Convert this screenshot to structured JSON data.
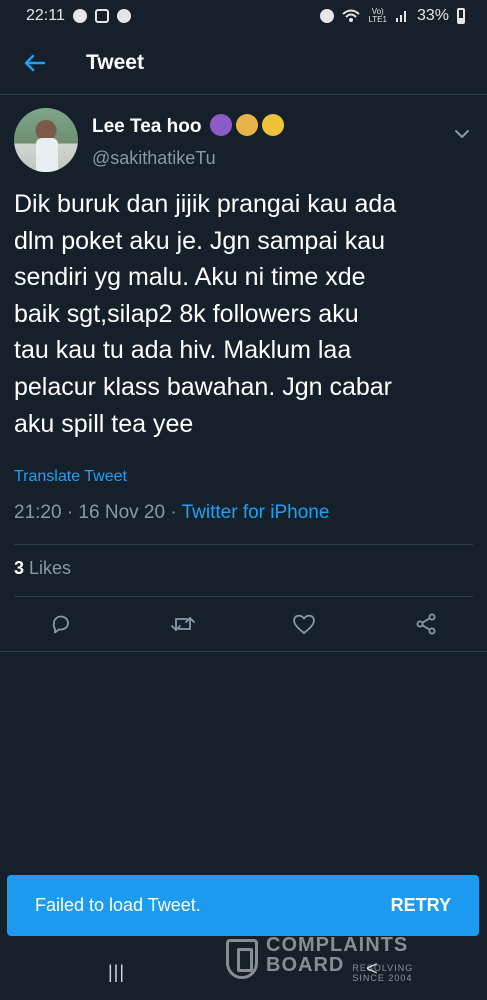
{
  "status_bar": {
    "time": "22:11",
    "network_label": "Vo)\nLTE1",
    "battery": "33%"
  },
  "header": {
    "title": "Tweet"
  },
  "tweet": {
    "author": {
      "display_name": "Lee Tea hoo",
      "handle": "@sakithatikeTu"
    },
    "text": "Dik buruk dan jijik prangai kau ada\ndlm poket aku je. Jgn sampai kau\nsendiri yg malu. Aku ni time xde\nbaik sgt,silap2 8k followers aku\ntau kau tu ada hiv. Maklum laa\npelacur klass bawahan. Jgn cabar\naku spill tea yee",
    "translate_label": "Translate Tweet",
    "timestamp": "21:20 · 16 Nov 20 · ",
    "source": "Twitter for iPhone",
    "likes_count": "3",
    "likes_label": " Likes"
  },
  "snackbar": {
    "message": "Failed to load Tweet.",
    "action": "RETRY"
  },
  "watermark": {
    "line1": "COMPLAINTS",
    "line2": "BOARD",
    "tag1": "RESOLVING",
    "tag2": "SINCE 2004"
  },
  "nav": {
    "recents_icon": "|||",
    "back_icon": "<"
  },
  "colors": {
    "background": "#15202b",
    "accent": "#1da1f2",
    "muted": "#8899a6",
    "snackbar": "#1d9bf0"
  },
  "icons": [
    "back-arrow-icon",
    "chevron-down-icon",
    "reply-icon",
    "retweet-icon",
    "like-icon",
    "share-icon"
  ]
}
